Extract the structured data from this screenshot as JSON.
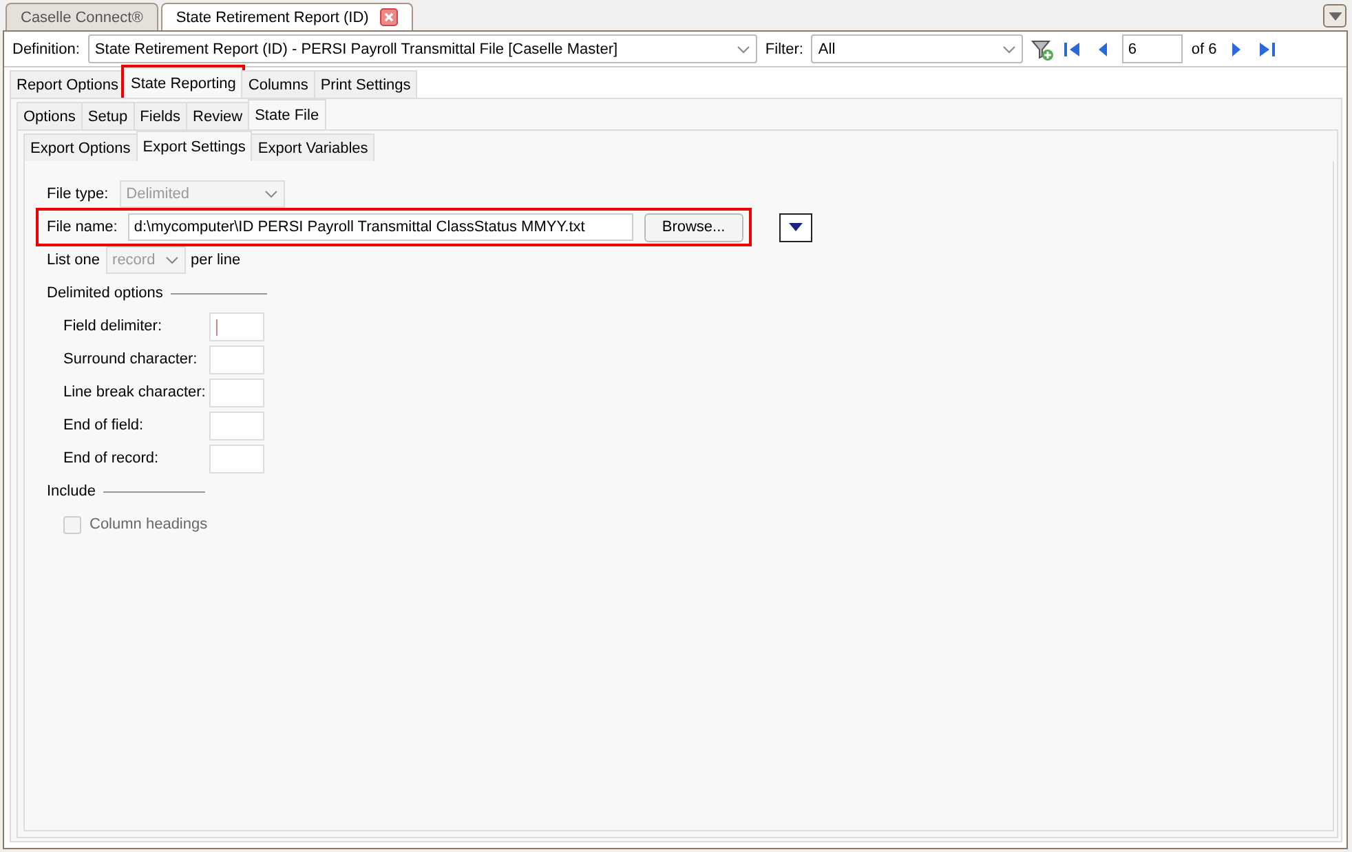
{
  "doc_tabs": [
    {
      "label": "Caselle Connect®",
      "selected": false,
      "closable": false
    },
    {
      "label": "State Retirement Report (ID)",
      "selected": true,
      "closable": true
    }
  ],
  "definition": {
    "label": "Definition:",
    "value": "State Retirement Report (ID) - PERSI Payroll Transmittal File [Caselle Master]"
  },
  "filter": {
    "label": "Filter:",
    "value": "All"
  },
  "pager": {
    "page": "6",
    "of": "of 6"
  },
  "tabs": [
    {
      "label": "Report Options",
      "selected": false,
      "highlighted": false
    },
    {
      "label": "State Reporting",
      "selected": true,
      "highlighted": true
    },
    {
      "label": "Columns",
      "selected": false,
      "highlighted": false
    },
    {
      "label": "Print Settings",
      "selected": false,
      "highlighted": false
    }
  ],
  "sub_tabs": [
    {
      "label": "Options",
      "selected": false
    },
    {
      "label": "Setup",
      "selected": false
    },
    {
      "label": "Fields",
      "selected": false
    },
    {
      "label": "Review",
      "selected": false
    },
    {
      "label": "State File",
      "selected": true
    }
  ],
  "export_tabs": [
    {
      "label": "Export Options",
      "selected": false
    },
    {
      "label": "Export Settings",
      "selected": true
    },
    {
      "label": "Export Variables",
      "selected": false
    }
  ],
  "file_type": {
    "label": "File type:",
    "value": "Delimited",
    "disabled": true
  },
  "file_name": {
    "label": "File name:",
    "value": "d:\\mycomputer\\ID PERSI Payroll Transmittal ClassStatus MMYY.txt",
    "button": "Browse...",
    "highlighted": true
  },
  "list_one": {
    "label": "List one",
    "value": "record",
    "suffix": "per line",
    "disabled": true
  },
  "delimited_options": {
    "title": "Delimited options",
    "fields": [
      {
        "label": "Field delimiter:",
        "focused": true
      },
      {
        "label": "Surround character:",
        "focused": false
      },
      {
        "label": "Line break character:",
        "focused": false
      },
      {
        "label": "End of field:",
        "focused": false
      },
      {
        "label": "End of record:",
        "focused": false
      }
    ]
  },
  "include": {
    "title": "Include",
    "options": [
      {
        "label": "Column headings",
        "checked": false,
        "disabled": true
      }
    ]
  }
}
